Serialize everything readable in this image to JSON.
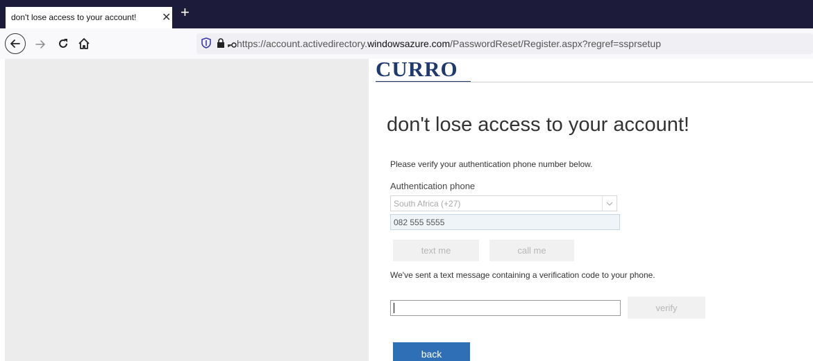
{
  "browser": {
    "tab_title": "don't lose access to your account!",
    "tab_close": "✕",
    "new_tab": "+",
    "url_prefix": "https://account.activedirectory.",
    "url_domain": "windowsazure.com",
    "url_suffix": "/PasswordReset/Register.aspx?regref=ssprsetup"
  },
  "logo": {
    "text": "CURRO",
    "color": "#1f3a6e"
  },
  "page": {
    "heading": "don't lose access to your account!",
    "instruction": "Please verify your authentication phone number below.",
    "phone_label": "Authentication phone",
    "country_value": "South Africa (+27)",
    "phone_value": "082 555 5555",
    "text_me_label": "text me",
    "call_me_label": "call me",
    "sent_message": "We've sent a text message containing a verification code to your phone.",
    "code_value": "",
    "verify_label": "verify",
    "back_label": "back"
  },
  "colors": {
    "tabstrip": "#1c1b3a",
    "primary_button": "#2f6fb5",
    "disabled_button": "#f1f1f1"
  },
  "icons": [
    "back-arrow-icon",
    "forward-arrow-icon",
    "reload-icon",
    "home-icon",
    "tracking-shield-icon",
    "lock-icon",
    "key-icon",
    "chevron-down-icon"
  ]
}
